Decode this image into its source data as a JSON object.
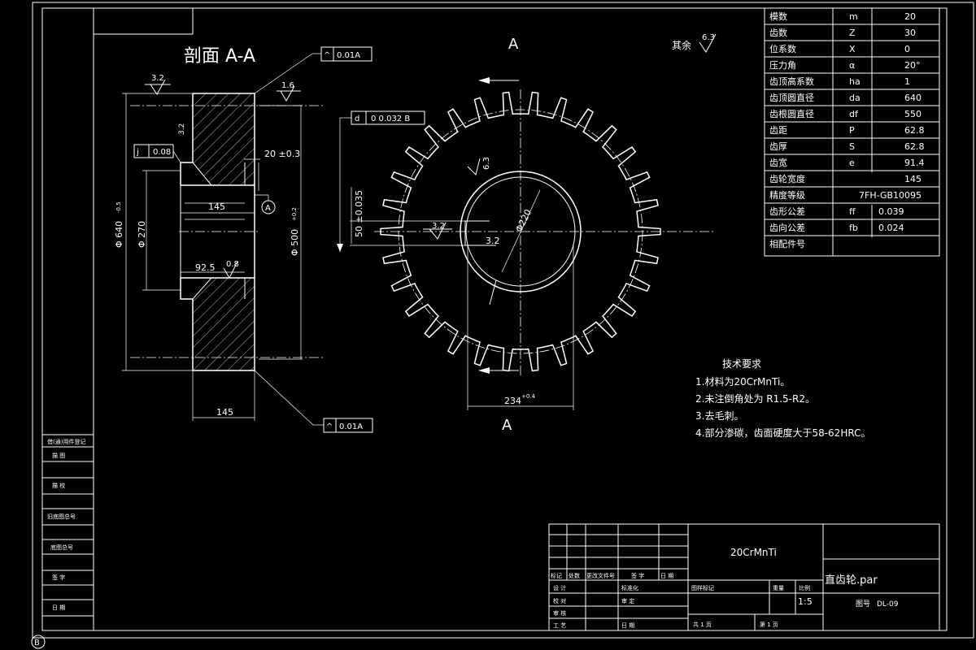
{
  "section_title": "剖面 A-A",
  "view_label_top": "A",
  "view_label_bottom": "A",
  "surface_other": {
    "label": "其余",
    "value": "6.3"
  },
  "tolerances": {
    "top_frame": {
      "symbol": "^",
      "value": "0.01A"
    },
    "bottom_frame": {
      "symbol": "^",
      "value": "0.01A"
    },
    "radial_frame": {
      "symbol": "d",
      "value": "0 0.032 B"
    },
    "runout_frame": {
      "symbol": "j",
      "value": "0.08"
    }
  },
  "roughness": [
    "3.2",
    "1.6",
    "3.2",
    "6.3",
    "3.2",
    "0.8"
  ],
  "dimensions": {
    "bore_width": "145",
    "overall_width": "145",
    "hub_offset": "92.5",
    "keyway": "20 ±0.3",
    "od": "Φ 640",
    "od_tol": "-0.5",
    "bore_dia": "Φ 270",
    "root_dia": "Φ 500",
    "root_tol": "+0.2",
    "key_depth": "50 ±0.035",
    "bore_circle": "Φ220",
    "hub_text": "3.2",
    "bottom_dim": "234",
    "bottom_tol": "+0.4",
    "datum_a": "A"
  },
  "param_table": [
    {
      "name": "模数",
      "sym": "m",
      "val": "20"
    },
    {
      "name": "齿数",
      "sym": "Z",
      "val": "30"
    },
    {
      "name": "位系数",
      "sym": "X",
      "val": "0"
    },
    {
      "name": "压力角",
      "sym": "α",
      "val": "20°"
    },
    {
      "name": "齿顶高系数",
      "sym": "ha",
      "val": "1"
    },
    {
      "name": "齿顶圆直径",
      "sym": "da",
      "val": "640"
    },
    {
      "name": "齿根圆直径",
      "sym": "df",
      "val": "550"
    },
    {
      "name": "齿距",
      "sym": "P",
      "val": "62.8"
    },
    {
      "name": "齿厚",
      "sym": "S",
      "val": "62.8"
    },
    {
      "name": "齿宽",
      "sym": "e",
      "val": "91.4"
    },
    {
      "name": "齿轮宽度",
      "sym": "",
      "val": "145"
    },
    {
      "name": "精度等级",
      "sym": "",
      "val": "7FH-GB10095"
    },
    {
      "name": "齿形公差",
      "sym": "ff",
      "val": "0.039"
    },
    {
      "name": "齿向公差",
      "sym": "fb",
      "val": "0.024"
    },
    {
      "name": "相配件号",
      "sym": "",
      "val": ""
    }
  ],
  "tech_req": {
    "title": "技术要求",
    "items": [
      "1.材料为20CrMnTi。",
      "2.未注倒角处为 R1.5-R2。",
      "3.去毛刺。",
      "4.部分渗碳，齿面硬度大于58-62HRC。"
    ]
  },
  "title_block": {
    "material": "20CrMnTi",
    "part_name": "直齿轮.par",
    "drawing_no_label": "图号",
    "drawing_no": "DL-09",
    "scale": "1:5",
    "headers": [
      "标记",
      "处数",
      "更改文件号",
      "签 字",
      "日 期"
    ],
    "rows": [
      "设 计",
      "校 对",
      "审 核",
      "工 艺"
    ],
    "standardize": "标准化",
    "approve": "审 定",
    "date": "日 期",
    "stage": "图样标记",
    "weight": "重量",
    "ratio": "比例",
    "sheets_total": "共 1 页",
    "sheet_no": "第 1 页"
  },
  "side_block": [
    "借(通)用件登记",
    "描 图",
    "描 校",
    "旧底图总号",
    "底图总号",
    "签 字",
    "日 期"
  ],
  "corner_mark": "B"
}
